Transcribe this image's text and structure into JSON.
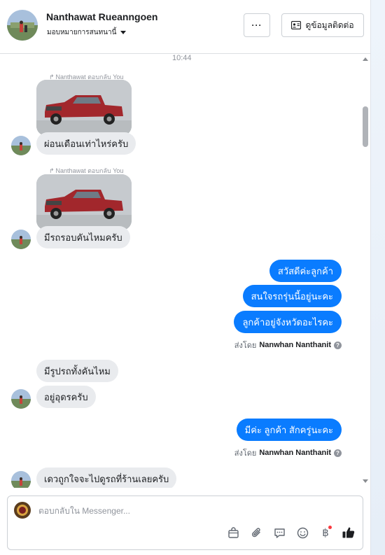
{
  "header": {
    "name": "Nanthawat Rueanngoen",
    "assignee": "มอบหมายการสนทนานี้",
    "more_label": "···",
    "contact_button": "ดูข้อมูลติดต่อ"
  },
  "chat": {
    "timestamp": "10:44",
    "messages": [
      {
        "reply_note": "Nanthawat ตอบกลับ You",
        "text": "ผ่อนเดือนเท่าไหร่ครับ"
      },
      {
        "reply_note": "Nanthawat ตอบกลับ You",
        "text": "มีรถรอบคันไหมครับ"
      },
      {
        "text": "สวัสดีค่ะลูกค้า"
      },
      {
        "text": "สนใจรถรุ่นนี้อยู่นะคะ"
      },
      {
        "text": "ลูกค้าอยู่จังหวัดอะไรคะ"
      },
      {
        "text": "มีรูปรถทั้งคันไหม"
      },
      {
        "text": "อยู่อุดรครับ"
      },
      {
        "text": "มีค่ะ ลูกค้า สักครู่นะคะ"
      },
      {
        "text": "เดวถูกใจจะไปดูรถที่ร้านเลยครับ"
      }
    ],
    "sent_by_label": "ส่งโดย",
    "sent_by_name": "Nanwhan Nanthanit"
  },
  "composer": {
    "placeholder": "ตอบกลับใน Messenger..."
  },
  "icons": [
    "bag-icon",
    "paperclip-icon",
    "saved-reply-icon",
    "emoji-icon",
    "baht-icon",
    "thumbs-up-icon"
  ],
  "colors": {
    "outgoing_bubble": "#0a7cff",
    "incoming_bubble": "#e9ebee",
    "thumbs_up": "#1c1e21"
  }
}
